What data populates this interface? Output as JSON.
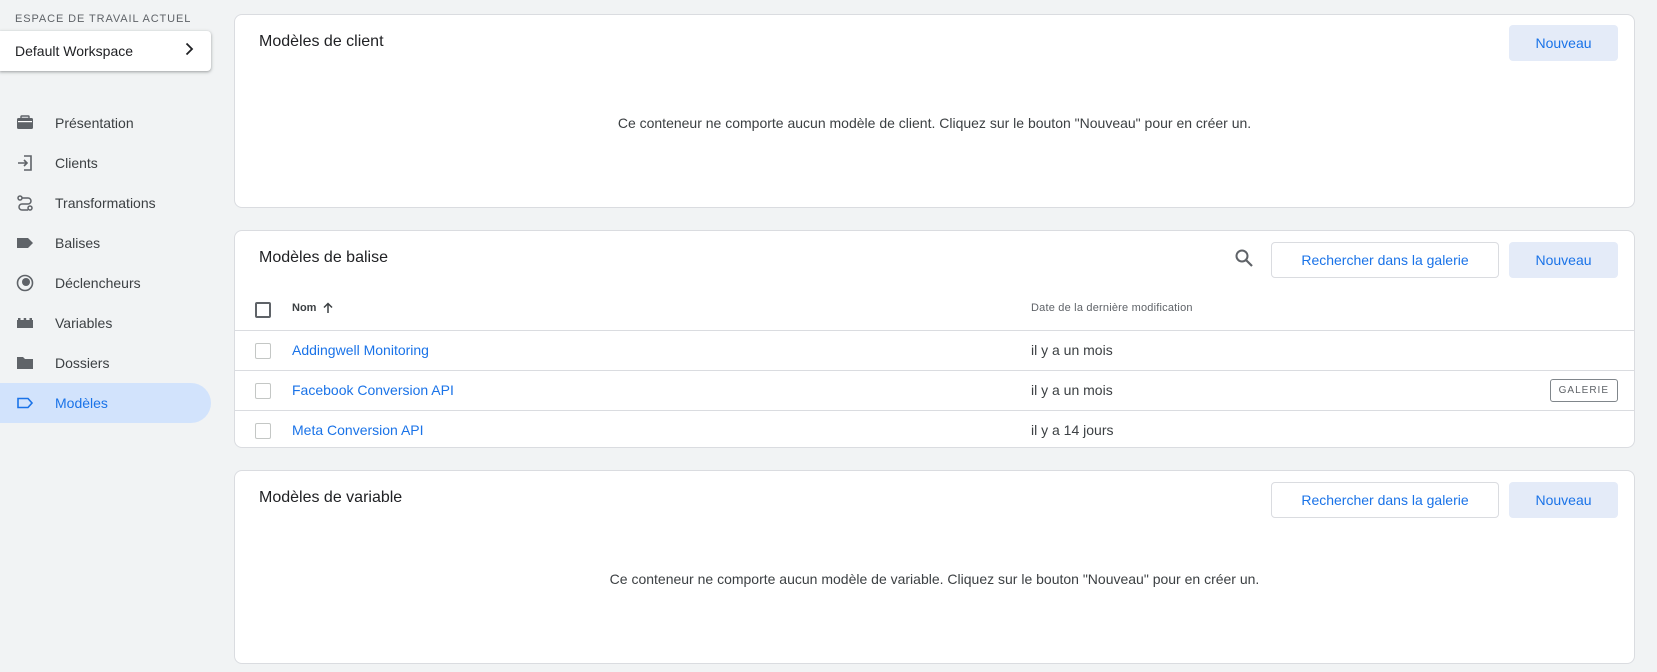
{
  "workspace": {
    "label": "ESPACE DE TRAVAIL ACTUEL",
    "name": "Default Workspace"
  },
  "nav": {
    "items": [
      {
        "label": "Présentation",
        "icon": "briefcase-icon"
      },
      {
        "label": "Clients",
        "icon": "login-icon"
      },
      {
        "label": "Transformations",
        "icon": "route-icon"
      },
      {
        "label": "Balises",
        "icon": "tag-icon"
      },
      {
        "label": "Déclencheurs",
        "icon": "trigger-icon"
      },
      {
        "label": "Variables",
        "icon": "variables-icon"
      },
      {
        "label": "Dossiers",
        "icon": "folder-icon"
      },
      {
        "label": "Modèles",
        "icon": "template-icon",
        "active": true
      }
    ]
  },
  "client_templates": {
    "title": "Modèles de client",
    "new_label": "Nouveau",
    "empty_message": "Ce conteneur ne comporte aucun modèle de client. Cliquez sur le bouton \"Nouveau\" pour en créer un."
  },
  "tag_templates": {
    "title": "Modèles de balise",
    "gallery_label": "Rechercher dans la galerie",
    "new_label": "Nouveau",
    "columns": {
      "name": "Nom",
      "date": "Date de la dernière modification"
    },
    "rows": [
      {
        "name": "Addingwell Monitoring",
        "date": "il y a un mois",
        "badge": ""
      },
      {
        "name": "Facebook Conversion API",
        "date": "il y a un mois",
        "badge": "GALERIE"
      },
      {
        "name": "Meta Conversion API",
        "date": "il y a 14 jours",
        "badge": ""
      }
    ]
  },
  "variable_templates": {
    "title": "Modèles de variable",
    "gallery_label": "Rechercher dans la galerie",
    "new_label": "Nouveau",
    "empty_message": "Ce conteneur ne comporte aucun modèle de variable. Cliquez sur le bouton \"Nouveau\" pour en créer un."
  },
  "colors": {
    "accent": "#1a73e8",
    "active_nav_bg": "#d2e3fc",
    "page_bg": "#f1f3f4"
  }
}
